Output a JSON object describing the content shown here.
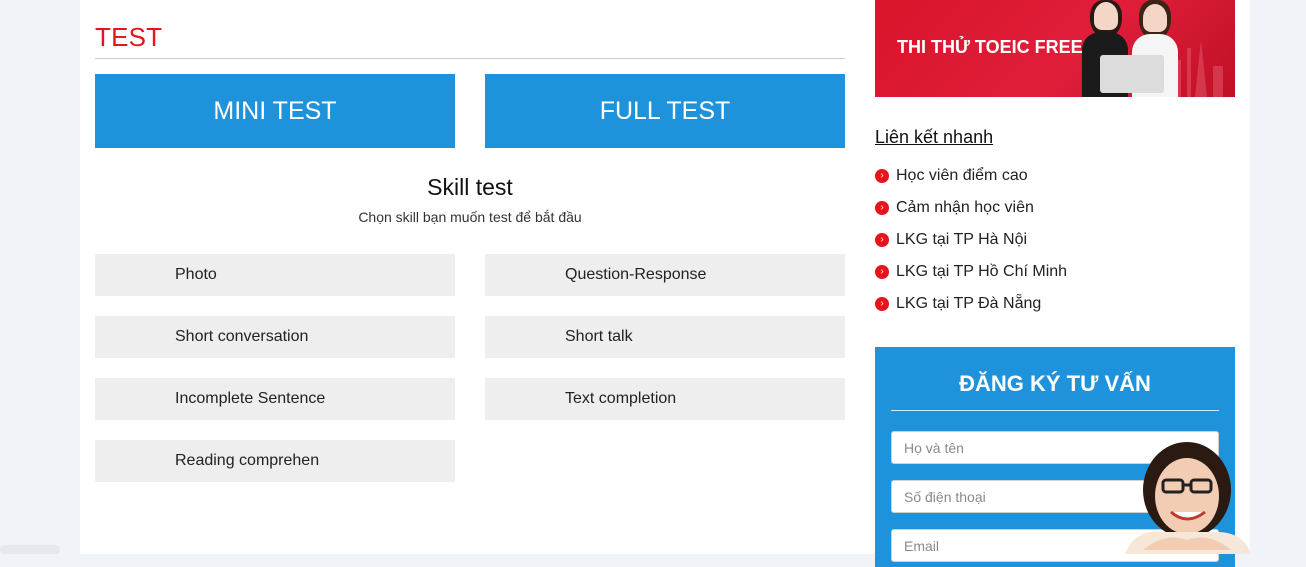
{
  "test_section": {
    "title": "TEST",
    "mini_test_label": "MINI TEST",
    "full_test_label": "FULL TEST"
  },
  "skill_test": {
    "heading": "Skill test",
    "subtitle": "Chọn skill bạn muốn test để bắt đầu",
    "items": [
      "Photo",
      "Question-Response",
      "Short conversation",
      "Short talk",
      "Incomplete Sentence",
      "Text completion",
      "Reading comprehen"
    ]
  },
  "banner": {
    "text": "THI THỬ TOEIC FREE"
  },
  "quick_links": {
    "title": "Liên kết nhanh",
    "items": [
      "Học viên điểm cao",
      "Cảm nhận học viên",
      "LKG tại TP Hà Nội",
      "LKG tại TP Hồ Chí Minh",
      "LKG tại TP Đà Nẵng"
    ]
  },
  "registration": {
    "title": "ĐĂNG KÝ TƯ VẤN",
    "name_placeholder": "Họ và tên",
    "phone_placeholder": "Số điện thoại",
    "email_placeholder": "Email"
  },
  "colors": {
    "accent_red": "#e8141b",
    "button_blue": "#1e93dc",
    "skill_bg": "#eeeeee"
  },
  "icons": {
    "quick_link_bullet": "chevron-right-circle-icon"
  }
}
